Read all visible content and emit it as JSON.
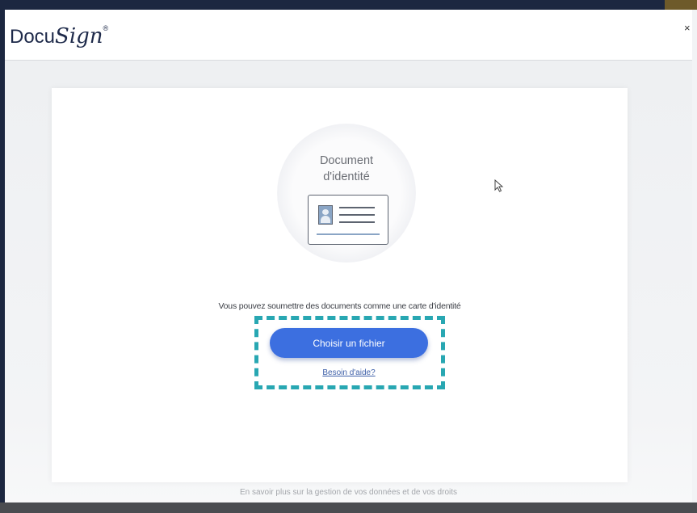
{
  "app": {
    "logo_text_docu": "Docu",
    "logo_text_sign": "Sign",
    "logo_trademark": "®",
    "close_symbol": "×"
  },
  "upload": {
    "document_title_line1": "Document",
    "document_title_line2": "d'identité",
    "info_text": "Vous pouvez soumettre des documents comme une carte d'identité",
    "choose_file_label": "Choisir un fichier",
    "help_link_label": "Besoin d'aide?"
  },
  "footer": {
    "privacy_text": "En savoir plus sur la gestion de vos données et de vos droits"
  },
  "icons": {
    "id_card": "id-card-icon",
    "cursor": "mouse-pointer-icon",
    "close": "close-icon"
  },
  "colors": {
    "accent_button": "#3c6fe0",
    "highlight_dashed": "#28a7b2",
    "link": "#3d5fa8"
  }
}
